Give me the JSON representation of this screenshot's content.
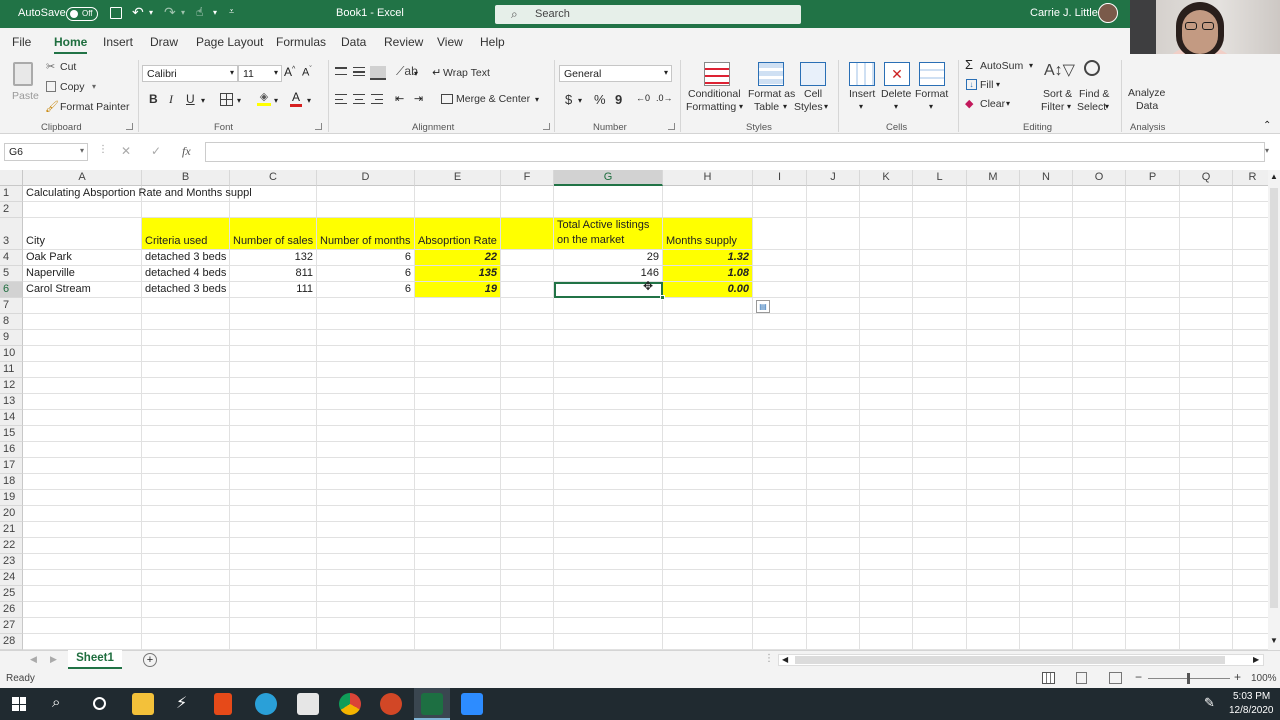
{
  "titlebar": {
    "autosave_label": "AutoSave",
    "autosave_state": "Off",
    "doc_title": "Book1  -  Excel",
    "search_placeholder": "Search",
    "user_name": "Carrie J. Little"
  },
  "menu_tabs": [
    "File",
    "Home",
    "Insert",
    "Draw",
    "Page Layout",
    "Formulas",
    "Data",
    "Review",
    "View",
    "Help"
  ],
  "ribbon": {
    "clipboard": {
      "paste": "Paste",
      "cut": "Cut",
      "copy": "Copy",
      "format_painter": "Format Painter",
      "group": "Clipboard"
    },
    "font": {
      "font_name": "Calibri",
      "font_size": "11",
      "bold": "B",
      "italic": "I",
      "underline": "U",
      "group": "Font"
    },
    "alignment": {
      "wrap_text": "Wrap Text",
      "merge_center": "Merge & Center",
      "group": "Alignment"
    },
    "number": {
      "format": "General",
      "currency": "$",
      "percent": "%",
      "comma": "9",
      "group": "Number"
    },
    "styles": {
      "conditional": "Conditional",
      "formatting": "Formatting",
      "format_as": "Format as",
      "table": "Table",
      "cell": "Cell",
      "cell_styles": "Styles",
      "group": "Styles"
    },
    "cells": {
      "insert": "Insert",
      "delete": "Delete",
      "format": "Format",
      "group": "Cells"
    },
    "editing": {
      "autosum": "AutoSum",
      "fill": "Fill",
      "clear": "Clear",
      "sort": "Sort &",
      "filter": "Filter",
      "find": "Find &",
      "select": "Select",
      "group": "Editing"
    },
    "analysis": {
      "analyze": "Analyze",
      "data": "Data",
      "group": "Analysis"
    }
  },
  "formula_bar": {
    "name_box": "G6",
    "fx": "fx",
    "content": ""
  },
  "columns": [
    "A",
    "B",
    "C",
    "D",
    "E",
    "F",
    "G",
    "H",
    "I",
    "J",
    "K",
    "L",
    "M",
    "N",
    "O",
    "P",
    "Q",
    "R"
  ],
  "rows": [
    "1",
    "2",
    "3",
    "4",
    "5",
    "6",
    "7",
    "8",
    "9",
    "10",
    "11",
    "12",
    "13",
    "14",
    "15",
    "16",
    "17",
    "18",
    "19",
    "20",
    "21",
    "22",
    "23",
    "24",
    "25",
    "26",
    "27",
    "28"
  ],
  "cells": {
    "A1": "Calculating Absportion Rate and Months suppl",
    "A3": "City",
    "B3": "Criteria used",
    "C3": "Number of sales",
    "D3": "Number of months",
    "E3": "Absoprtion Rate",
    "G3a": "Total Active listings",
    "G3b": "on the market",
    "H3": "Months supply",
    "A4": "Oak Park",
    "B4": "detached 3 beds",
    "C4": "132",
    "D4": "6",
    "E4": "22",
    "G4": "29",
    "H4": "1.32",
    "A5": "Naperville",
    "B5": "detached 4 beds",
    "C5": "811",
    "D5": "6",
    "E5": "135",
    "G5": "146",
    "H5": "1.08",
    "A6": "Carol Stream",
    "B6": "detached 3 beds",
    "C6": "111",
    "D6": "6",
    "E6": "19",
    "G6": "",
    "H6": "0.00"
  },
  "sheet_tab": "Sheet1",
  "status": {
    "ready": "Ready",
    "zoom": "100%"
  },
  "clock": {
    "time": "5:03 PM",
    "date": "12/8/2020"
  },
  "colors": {
    "excel_green": "#217346",
    "highlight": "#ffff00"
  }
}
